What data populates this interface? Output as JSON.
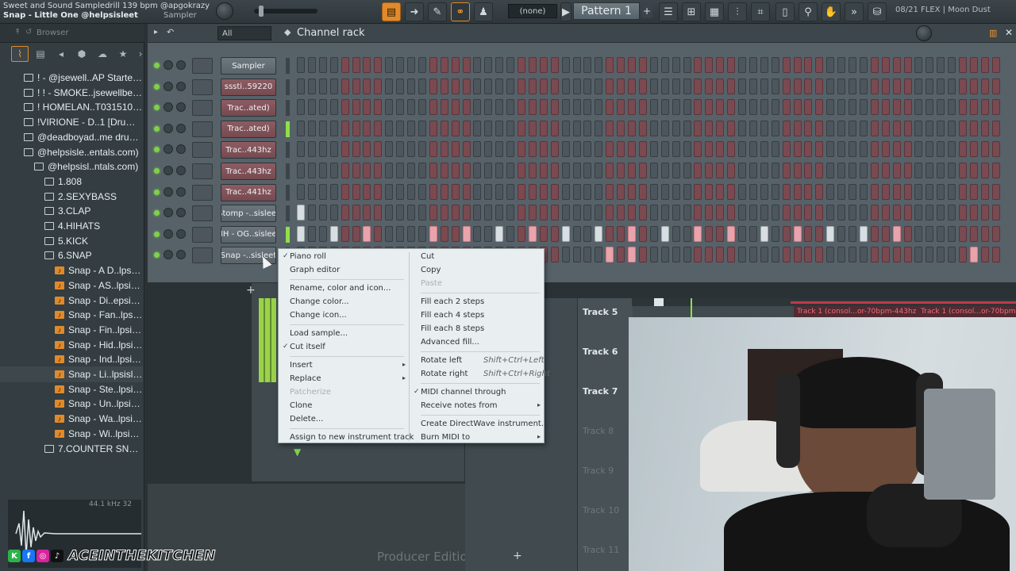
{
  "topbar": {
    "song_line": "Sweet and Sound Sampledrill 139 bpm @apgokrazy",
    "hint_line": "Snap - Little One @helpsisleet",
    "sampler_label": "Sampler",
    "pattern_none": "(none)",
    "pattern_name": "Pattern 1",
    "pattern_add": "+",
    "news": "08/21  FLEX | Moon Dust"
  },
  "browser": {
    "title": "Browser",
    "items": [
      {
        "label": "! - @jsewell..AP Starter Kit",
        "depth": 0,
        "type": "folder"
      },
      {
        "label": "! ! - SMOKE..jsewellbeats",
        "depth": 0,
        "type": "folder"
      },
      {
        "label": "! HOMELAN..T0315102-001",
        "depth": 0,
        "type": "folder"
      },
      {
        "label": "!VIRIONE - D..1 [Drum Kit]",
        "depth": 0,
        "type": "folder"
      },
      {
        "label": "@deadboyad..me drumkit",
        "depth": 0,
        "type": "folder"
      },
      {
        "label": "@helpsisle..entals.com)",
        "depth": 0,
        "type": "folder"
      },
      {
        "label": "@helpsisl..ntals.com)",
        "depth": 1,
        "type": "folder"
      },
      {
        "label": "1.808",
        "depth": 2,
        "type": "folder"
      },
      {
        "label": "2.SEXYBASS",
        "depth": 2,
        "type": "folder"
      },
      {
        "label": "3.CLAP",
        "depth": 2,
        "type": "folder"
      },
      {
        "label": "4.HIHATS",
        "depth": 2,
        "type": "folder"
      },
      {
        "label": "5.KICK",
        "depth": 2,
        "type": "folder"
      },
      {
        "label": "6.SNAP",
        "depth": 2,
        "type": "folder"
      },
      {
        "label": "Snap - A D..lpsisleet",
        "depth": 3,
        "type": "file"
      },
      {
        "label": "Snap - AS..lpsisleet",
        "depth": 3,
        "type": "file"
      },
      {
        "label": "Snap - Di..epsisleet",
        "depth": 3,
        "type": "file"
      },
      {
        "label": "Snap - Fan..lpsisleet",
        "depth": 3,
        "type": "file"
      },
      {
        "label": "Snap - Fin..lpsisleet",
        "depth": 3,
        "type": "file"
      },
      {
        "label": "Snap - Hid..lpsisleet",
        "depth": 3,
        "type": "file"
      },
      {
        "label": "Snap - Ind..lpsisleet",
        "depth": 3,
        "type": "file"
      },
      {
        "label": "Snap - Li..lpsisleet",
        "depth": 3,
        "type": "file",
        "selected": true
      },
      {
        "label": "Snap - Ste..lpsisleet",
        "depth": 3,
        "type": "file"
      },
      {
        "label": "Snap - Un..lpsisleet",
        "depth": 3,
        "type": "file"
      },
      {
        "label": "Snap - Wa..lpsisleet",
        "depth": 3,
        "type": "file"
      },
      {
        "label": "Snap - Wi..lpsisleet",
        "depth": 3,
        "type": "file"
      },
      {
        "label": "7.COUNTER SNARE",
        "depth": 2,
        "type": "folder"
      }
    ],
    "wave_info": "44.1 kHz 32"
  },
  "rack": {
    "title": "Channel rack",
    "filter": "All",
    "channels": [
      {
        "name": "Sampler",
        "steps_on": [],
        "meter": false,
        "highlight": false
      },
      {
        "name": "sssti..59220",
        "steps_on": [],
        "meter": false,
        "highlight": true
      },
      {
        "name": "Trac..ated)",
        "steps_on": [],
        "meter": false,
        "highlight": true
      },
      {
        "name": "Trac..ated)",
        "steps_on": [],
        "meter": true,
        "highlight": true
      },
      {
        "name": "Trac..443hz",
        "steps_on": [],
        "meter": false,
        "highlight": true
      },
      {
        "name": "Trac..443hz",
        "steps_on": [],
        "meter": false,
        "highlight": true
      },
      {
        "name": "Trac..441hz",
        "steps_on": [],
        "meter": false,
        "highlight": true
      },
      {
        "name": "Stomp -..sisleet",
        "steps_on": [
          0
        ],
        "meter": false,
        "highlight": false
      },
      {
        "name": "HH - OG..sisleet",
        "steps_on": [
          0,
          3,
          6,
          12,
          15,
          18,
          21,
          24,
          27,
          30,
          33,
          36,
          39,
          42,
          45,
          48,
          51,
          54
        ],
        "meter": true,
        "highlight": false
      },
      {
        "name": "Snap -..sisleet",
        "steps_on": [
          28,
          30,
          61
        ],
        "meter": false,
        "highlight": false
      }
    ]
  },
  "context_menu": {
    "left": [
      {
        "label": "Piano roll",
        "checked": true
      },
      {
        "label": "Graph editor"
      },
      {
        "label": "Rename, color and icon..."
      },
      {
        "label": "Change color..."
      },
      {
        "label": "Change icon..."
      },
      {
        "label": "Load sample..."
      },
      {
        "label": "Cut itself",
        "checked": true
      },
      {
        "label": "Insert",
        "submenu": true
      },
      {
        "label": "Replace",
        "submenu": true
      },
      {
        "label": "Patcherize",
        "disabled": true
      },
      {
        "label": "Clone"
      },
      {
        "label": "Delete..."
      },
      {
        "label": "Assign to new instrument track"
      }
    ],
    "right": [
      {
        "label": "Cut"
      },
      {
        "label": "Copy"
      },
      {
        "label": "Paste",
        "disabled": true
      },
      {
        "label": "Fill each 2 steps"
      },
      {
        "label": "Fill each 4 steps"
      },
      {
        "label": "Fill each 8 steps"
      },
      {
        "label": "Advanced fill..."
      },
      {
        "label": "Rotate left",
        "shortcut": "Shift+Ctrl+Left"
      },
      {
        "label": "Rotate right",
        "shortcut": "Shift+Ctrl+Right"
      },
      {
        "label": "MIDI channel through",
        "checked": true
      },
      {
        "label": "Receive notes from",
        "submenu": true
      },
      {
        "label": "Create DirectWave instrument..."
      },
      {
        "label": "Burn MIDI to",
        "submenu": true
      }
    ]
  },
  "playlist": {
    "tracks": [
      "Track 5",
      "Track 6",
      "Track 7",
      "Track 8",
      "Track 9",
      "Track 10",
      "Track 11"
    ],
    "clip_label": "Track 1 (consol...or-70bpm-443hz",
    "clip_label2": "Track 1 (consol...or-70bpm-443"
  },
  "watermark": "Producer Edition",
  "social": {
    "handle": "ACEINTHEKITCHEN"
  },
  "colors": {
    "accent": "#e08a2a",
    "step_pink": "#7a4a50",
    "led_green": "#7fd04a"
  }
}
